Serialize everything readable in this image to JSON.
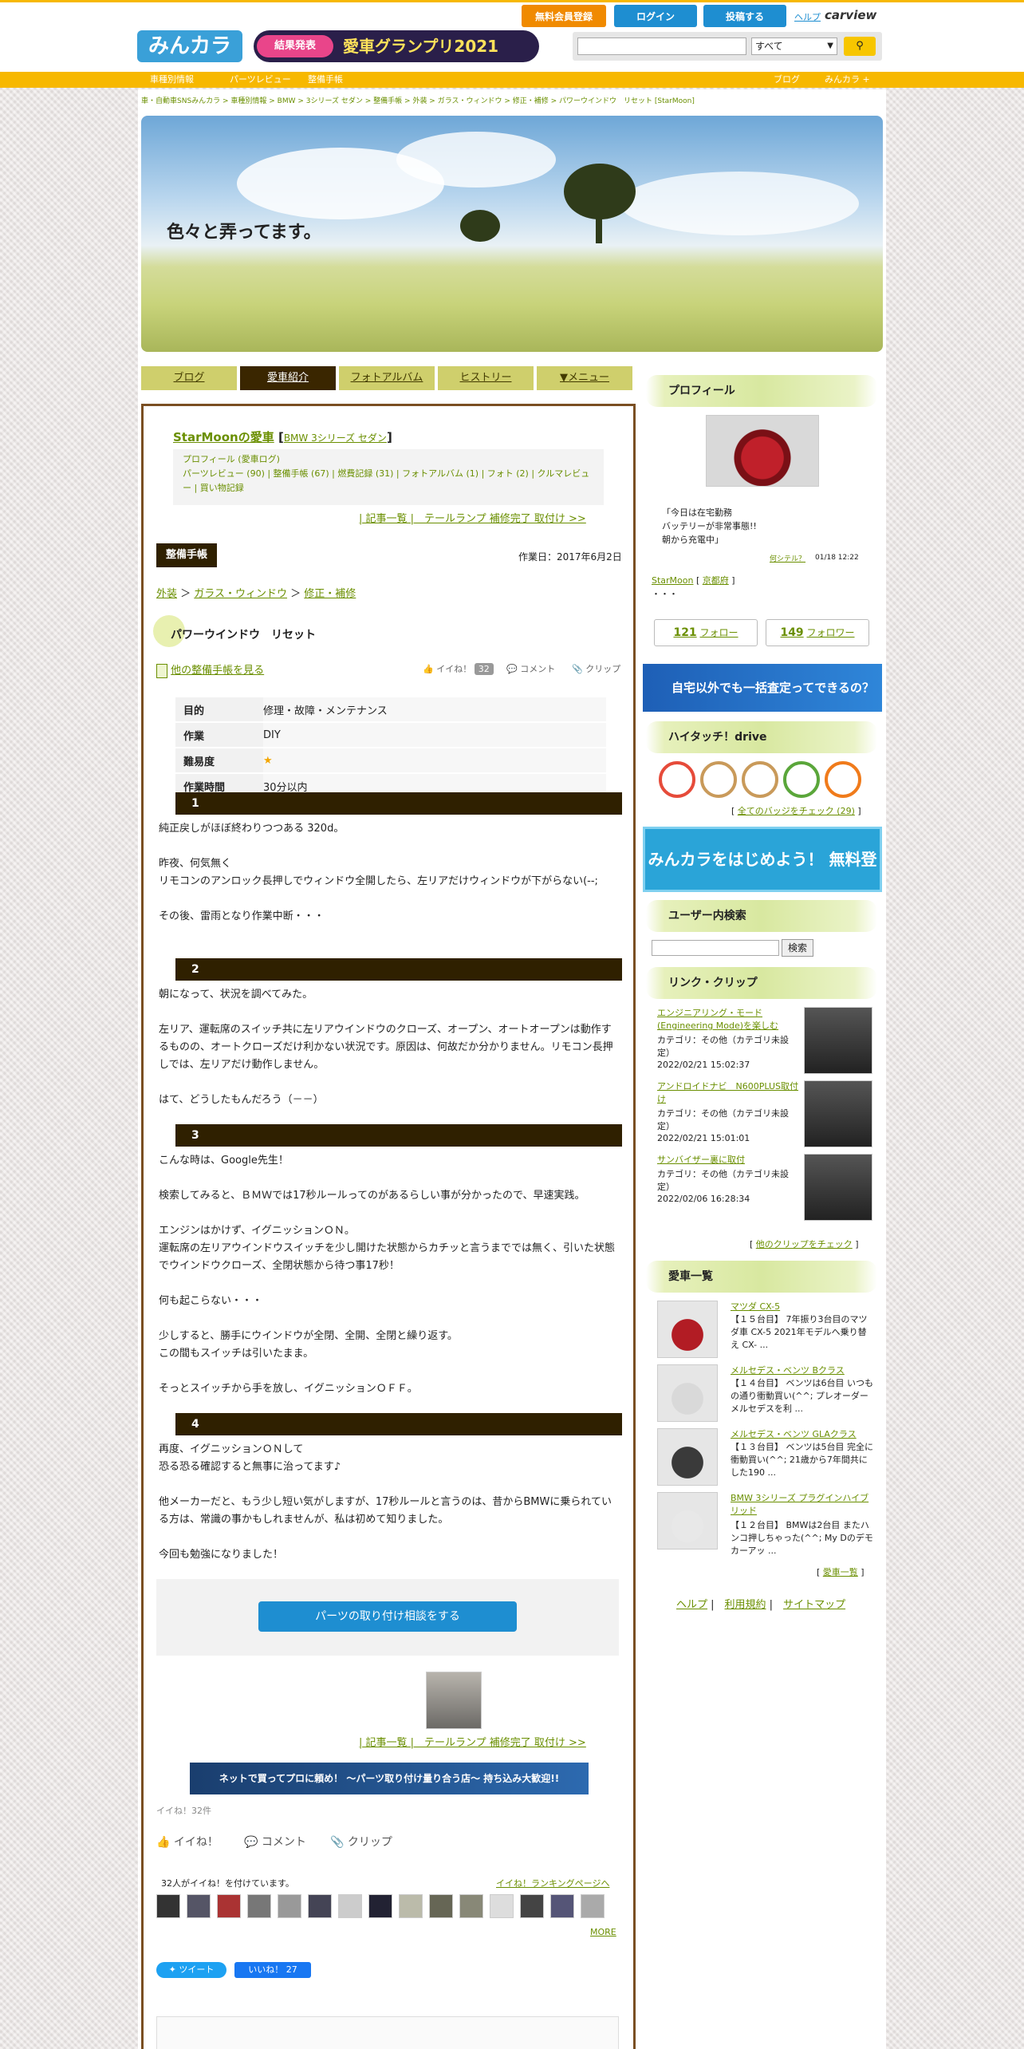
{
  "header": {
    "logo": "みんカラ",
    "banner_badge": "結果発表",
    "banner_text": "愛車グランプリ2021",
    "buttons": {
      "signup": "無料会員登録",
      "login": "ログイン",
      "post": "投稿する",
      "help": "ヘルプ",
      "carview": "carview"
    },
    "search": {
      "placeholder": "",
      "select": "すべて"
    }
  },
  "nav": {
    "left": [
      "車種別情報",
      "パーツレビュー",
      "整備手帳"
    ],
    "right": [
      "ブログ",
      "みんカラ +"
    ]
  },
  "breadcrumb": "車・自動車SNSみんカラ > 車種別情報 > BMW > 3シリーズ セダン > 整備手帳 > 外装 > ガラス・ウィンドウ > 修正・補修 > パワーウインドウ　リセット [StarMoon]",
  "banner_title": "色々と弄ってます。",
  "tabs": [
    "ブログ",
    "愛車紹介",
    "フォトアルバム",
    "ヒストリー",
    "▼メニュー"
  ],
  "car": {
    "owner_link": "StarMoonの愛車",
    "model": "BMW 3シリーズ セダン",
    "links": "プロフィール (愛車ログ)\nパーツレビュー (90) | 整備手帳 (67) | 燃費記録 (31) | フォトアルバム (1) | フォト (2) | クルマレビュー | 買い物記録",
    "nav": "| 記事一覧 |　テールランプ 補修完了 取付け >>"
  },
  "article": {
    "badge": "整備手帳",
    "date": "作業日：2017年6月2日",
    "cats": [
      "外装",
      "ガラス・ウィンドウ",
      "修正・補修"
    ],
    "title": "パワーウインドウ　リセット",
    "other_link": "他の整備手帳を見る",
    "like": "イイね！",
    "like_count": "32",
    "comment": "コメント",
    "clip": "クリップ",
    "spec": [
      [
        "目的",
        "修理・故障・メンテナンス"
      ],
      [
        "作業",
        "DIY"
      ],
      [
        "難易度",
        "★"
      ],
      [
        "作業時間",
        "30分以内"
      ]
    ],
    "steps": [
      {
        "num": "1",
        "text": "純正戻しがほぼ終わりつつある 320d。\n\n昨夜、何気無く\nリモコンのアンロック長押しでウィンドウ全開したら、左リアだけウィンドウが下がらない(--;\n\nその後、雷雨となり作業中断・・・"
      },
      {
        "num": "2",
        "text": "朝になって、状況を調べてみた。\n\n左リア、運転席のスイッチ共に左リアウインドウのクローズ、オープン、オートオープンは動作するものの、オートクローズだけ利かない状況です。原因は、何故だか分かりません。リモコン長押しでは、左リアだけ動作しません。\n\nはて、どうしたもんだろう（－－）"
      },
      {
        "num": "3",
        "text": "こんな時は、Google先生！\n\n検索してみると、ＢＭＷでは17秒ルールってのがあるらしい事が分かったので、早速実践。\n\nエンジンはかけず、イグニッションＯＮ。\n運転席の左リアウインドウスイッチを少し開けた状態からカチッと言うまででは無く、引いた状態でウインドウクローズ、全閉状態から待つ事17秒！\n\n何も起こらない・・・\n\n少しすると、勝手にウインドウが全閉、全開、全閉と繰り返す。\nこの間もスイッチは引いたまま。\n\nそっとスイッチから手を放し、イグニッションＯＦＦ。"
      },
      {
        "num": "4",
        "text": "再度、イグニッションＯＮして\n恐る恐る確認すると無事に治ってます♪\n\n他メーカーだと、もう少し短い気がしますが、17秒ルールと言うのは、昔からBMWに乗られている方は、常識の事かもしれませんが、私は初めて知りました。\n\n今回も勉強になりました！"
      }
    ],
    "consult_button": "パーツの取り付け相談をする",
    "ad_text": "ネットで買ってプロに頼め！ ～パーツ取り付け量り合う店～ 持ち込み大歓迎!!",
    "like_summary": "イイね！32件",
    "liked_by": "32人がイイね！を付けています。",
    "ranking_link": "イイね！ランキングページへ",
    "more": "MORE",
    "tweet": "ツイート",
    "fb_like": "いいね！",
    "fb_count": "27"
  },
  "sidebar": {
    "profile_h": "プロフィール",
    "profile_text": "「今日は在宅勤務\nバッテリーが非常事態!!\n朝から充電中」",
    "profile_link": "何シテル？",
    "profile_time": "01/18 12:22",
    "user": "StarMoon",
    "user_area": "京都府",
    "dots": "・・・",
    "follow": {
      "count": "121",
      "label": "フォロー"
    },
    "follower": {
      "count": "149",
      "label": "フォロワー"
    },
    "ad1": "自宅以外でも一括査定ってできるの？",
    "hitouch_h": "ハイタッチ！drive",
    "badge_link": "全てのバッジをチェック (29)",
    "minkara_banner": "みんカラをはじめよう！ 無料登録",
    "usersearch_h": "ユーザー内検索",
    "search_btn": "検索",
    "clips_h": "リンク・クリップ",
    "clips": [
      {
        "title": "エンジニアリング・モード(Engineering Mode)を楽しむ",
        "cat": "カテゴリ：その他（カテゴリ未設定）",
        "date": "2022/02/21 15:02:37"
      },
      {
        "title": "アンドロイドナビ　N600PLUS取付け",
        "cat": "カテゴリ：その他（カテゴリ未設定）",
        "date": "2022/02/21 15:01:01"
      },
      {
        "title": "サンバイザー裏に取付",
        "cat": "カテゴリ：その他（カテゴリ未設定）",
        "date": "2022/02/06 16:28:34"
      }
    ],
    "clips_more": "他のクリップをチェック",
    "cars_h": "愛車一覧",
    "cars": [
      {
        "name": "マツダ CX-5",
        "desc": "【１５台目】 7年振り3台目のマツダ車 CX-5 2021年モデルへ乗り替え CX- ..."
      },
      {
        "name": "メルセデス・ベンツ Bクラス",
        "desc": "【１４台目】 ベンツは6台目 いつもの通り衝動買い(^^; プレオーダーメルセデスを利 ..."
      },
      {
        "name": "メルセデス・ベンツ GLAクラス",
        "desc": "【１３台目】 ベンツは5台目 完全に衝動買い(^^; 21歳から7年間共にした190 ..."
      },
      {
        "name": "BMW 3シリーズ プラグインハイブリッド",
        "desc": "【１２台目】 BMWは2台目 またハンコ押しちゃった(^^; My Dのデモカーアッ ..."
      }
    ],
    "cars_more": "愛車一覧",
    "footer": [
      "ヘルプ",
      "利用規約",
      "サイトマップ"
    ]
  }
}
